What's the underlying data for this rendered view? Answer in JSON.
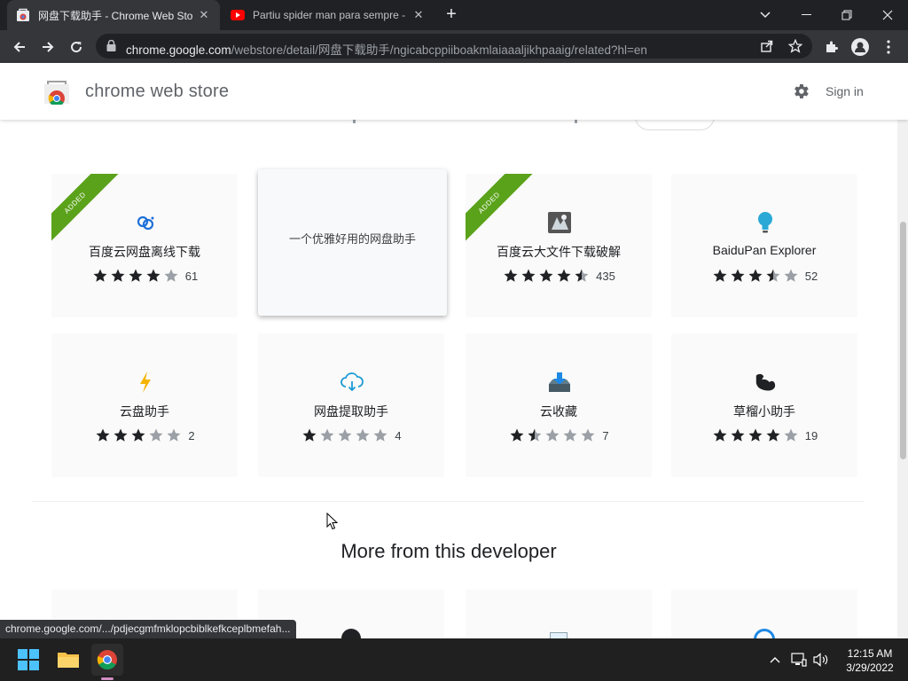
{
  "browser": {
    "tabs": [
      {
        "title": "网盘下载助手 - Chrome Web Sto",
        "favicon": "chrome-web-store-icon",
        "active": true
      },
      {
        "title": "Partiu spider man para sempre -",
        "favicon": "youtube-icon",
        "active": false
      }
    ],
    "url_host": "chrome.google.com",
    "url_path": "/webstore/detail/网盘下载助手/ngicabcppiiboakmlaiaaaljikhpaaig/related?hl=en",
    "status_url": "chrome.google.com/.../pdjecgmfmklopcbiblkefkceplbmefah..."
  },
  "header": {
    "title": "chrome web store",
    "signin": "Sign in"
  },
  "related": [
    {
      "name": "百度云网盘离线下载",
      "rating": 4,
      "count": "61",
      "added": true,
      "icon": "link-icon",
      "ribbon": "ADDED"
    },
    {
      "description": "一个优雅好用的网盘助手",
      "hover": true
    },
    {
      "name": "百度云大文件下载破解",
      "rating": 4.5,
      "count": "435",
      "added": true,
      "icon": "app-tile-icon",
      "ribbon": "ADDED"
    },
    {
      "name": "BaiduPan Explorer",
      "rating": 3.5,
      "count": "52",
      "added": false,
      "icon": "lightbulb-icon"
    },
    {
      "name": "云盘助手",
      "rating": 3,
      "count": "2",
      "added": false,
      "icon": "lightning-icon"
    },
    {
      "name": "网盘提取助手",
      "rating": 1,
      "count": "4",
      "added": false,
      "icon": "cloud-download-icon"
    },
    {
      "name": "云收藏",
      "rating": 1.5,
      "count": "7",
      "added": false,
      "icon": "download-tray-icon"
    },
    {
      "name": "草榴小助手",
      "rating": 4,
      "count": "19",
      "added": false,
      "icon": "muscle-icon"
    }
  ],
  "more_title": "More from this developer",
  "taskbar": {
    "time": "12:15 AM",
    "date": "3/29/2022"
  },
  "colors": {
    "ribbon": "#5ba21b",
    "star": "#202124",
    "star_empty": "#9aa0a6"
  }
}
